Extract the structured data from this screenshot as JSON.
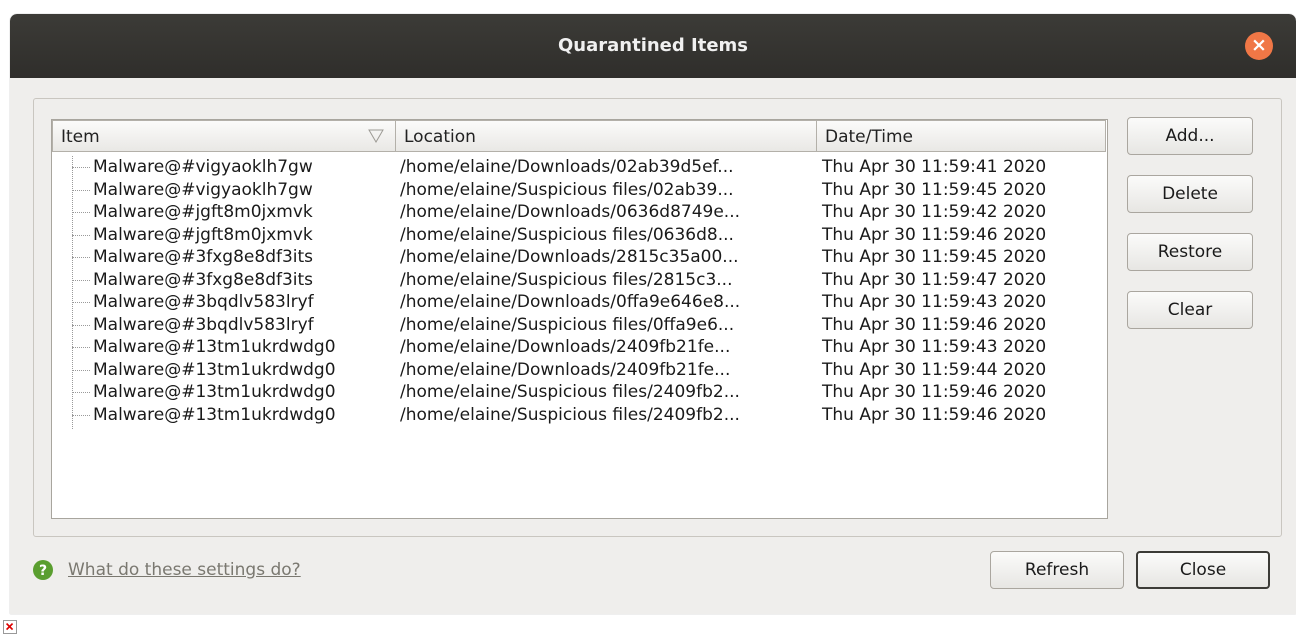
{
  "window": {
    "title": "Quarantined Items",
    "close_glyph": "×"
  },
  "table": {
    "columns": [
      "Item",
      "Location",
      "Date/Time"
    ],
    "sort_indicator": "sort-descending-icon",
    "rows": [
      {
        "item": "Malware@#vigyaoklh7gw",
        "location": "/home/elaine/Downloads/02ab39d5ef...",
        "datetime": "Thu Apr 30 11:59:41 2020"
      },
      {
        "item": "Malware@#vigyaoklh7gw",
        "location": "/home/elaine/Suspicious files/02ab39...",
        "datetime": "Thu Apr 30 11:59:45 2020"
      },
      {
        "item": "Malware@#jgft8m0jxmvk",
        "location": "/home/elaine/Downloads/0636d8749e...",
        "datetime": "Thu Apr 30 11:59:42 2020"
      },
      {
        "item": "Malware@#jgft8m0jxmvk",
        "location": "/home/elaine/Suspicious files/0636d8...",
        "datetime": "Thu Apr 30 11:59:46 2020"
      },
      {
        "item": "Malware@#3fxg8e8df3its",
        "location": "/home/elaine/Downloads/2815c35a00...",
        "datetime": "Thu Apr 30 11:59:45 2020"
      },
      {
        "item": "Malware@#3fxg8e8df3its",
        "location": "/home/elaine/Suspicious files/2815c3...",
        "datetime": "Thu Apr 30 11:59:47 2020"
      },
      {
        "item": "Malware@#3bqdlv583lryf",
        "location": "/home/elaine/Downloads/0ffa9e646e8...",
        "datetime": "Thu Apr 30 11:59:43 2020"
      },
      {
        "item": "Malware@#3bqdlv583lryf",
        "location": "/home/elaine/Suspicious files/0ffa9e6...",
        "datetime": "Thu Apr 30 11:59:46 2020"
      },
      {
        "item": "Malware@#13tm1ukrdwdg0",
        "location": "/home/elaine/Downloads/2409fb21fe...",
        "datetime": "Thu Apr 30 11:59:43 2020"
      },
      {
        "item": "Malware@#13tm1ukrdwdg0",
        "location": "/home/elaine/Downloads/2409fb21fe...",
        "datetime": "Thu Apr 30 11:59:44 2020"
      },
      {
        "item": "Malware@#13tm1ukrdwdg0",
        "location": "/home/elaine/Suspicious files/2409fb2...",
        "datetime": "Thu Apr 30 11:59:46 2020"
      },
      {
        "item": "Malware@#13tm1ukrdwdg0",
        "location": "/home/elaine/Suspicious files/2409fb2...",
        "datetime": "Thu Apr 30 11:59:46 2020"
      }
    ]
  },
  "side_buttons": {
    "add": "Add...",
    "delete": "Delete",
    "restore": "Restore",
    "clear": "Clear"
  },
  "footer": {
    "help_icon": "help-question-icon",
    "help_link": "What do these settings do?",
    "refresh": "Refresh",
    "close": "Close"
  },
  "colors": {
    "titlebar": "#3c3b37",
    "close_button": "#f07746",
    "help_icon": "#5a9e2f",
    "window_bg": "#efeeec"
  }
}
